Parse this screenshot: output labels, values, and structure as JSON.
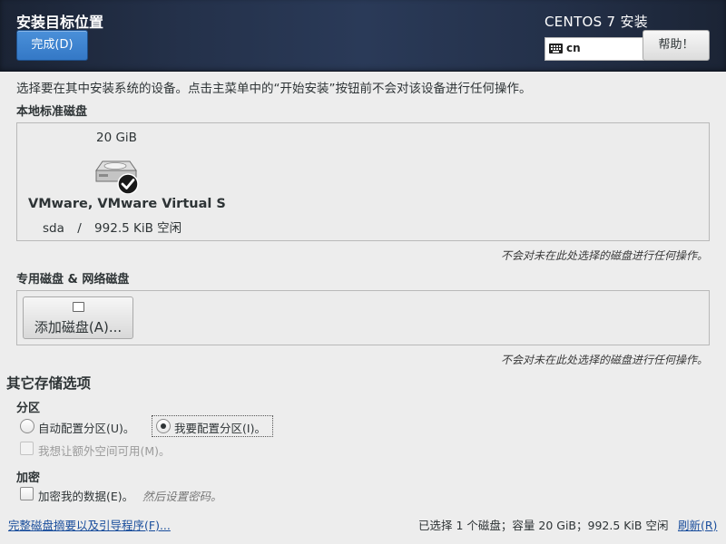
{
  "header": {
    "title": "安装目标位置",
    "done_label": "完成(D)",
    "product": "CENTOS 7 安装",
    "keyboard_layout": "cn",
    "help_label": "帮助！"
  },
  "hint": "选择要在其中安装系统的设备。点击主菜单中的“开始安装”按钮前不会对该设备进行任何操作。",
  "local_disks": {
    "label": "本地标准磁盘",
    "disk": {
      "size": "20 GiB",
      "name": "VMware, VMware Virtual S",
      "device": "sda",
      "separator": "/",
      "free": "992.5 KiB 空闲",
      "selected": true
    },
    "note": "不会对未在此处选择的磁盘进行任何操作。"
  },
  "specialized_disks": {
    "label": "专用磁盘 & 网络磁盘",
    "add_label": "添加磁盘(A)...",
    "note": "不会对未在此处选择的磁盘进行任何操作。"
  },
  "other_options": {
    "label": "其它存储选项",
    "partitioning": {
      "label": "分区",
      "auto_label": "自动配置分区(U)。",
      "manual_label": "我要配置分区(I)。",
      "selected": "manual",
      "extra_space_label": "我想让额外空间可用(M)。"
    },
    "encryption": {
      "label": "加密",
      "encrypt_label": "加密我的数据(E)。",
      "encrypt_hint": "然后设置密码。"
    }
  },
  "footer": {
    "summary_link": "完整磁盘摘要以及引导程序(F)...",
    "summary": "已选择 1 个磁盘；容量 20 GiB；992.5 KiB 空闲",
    "refresh_label": "刷新(R)"
  }
}
